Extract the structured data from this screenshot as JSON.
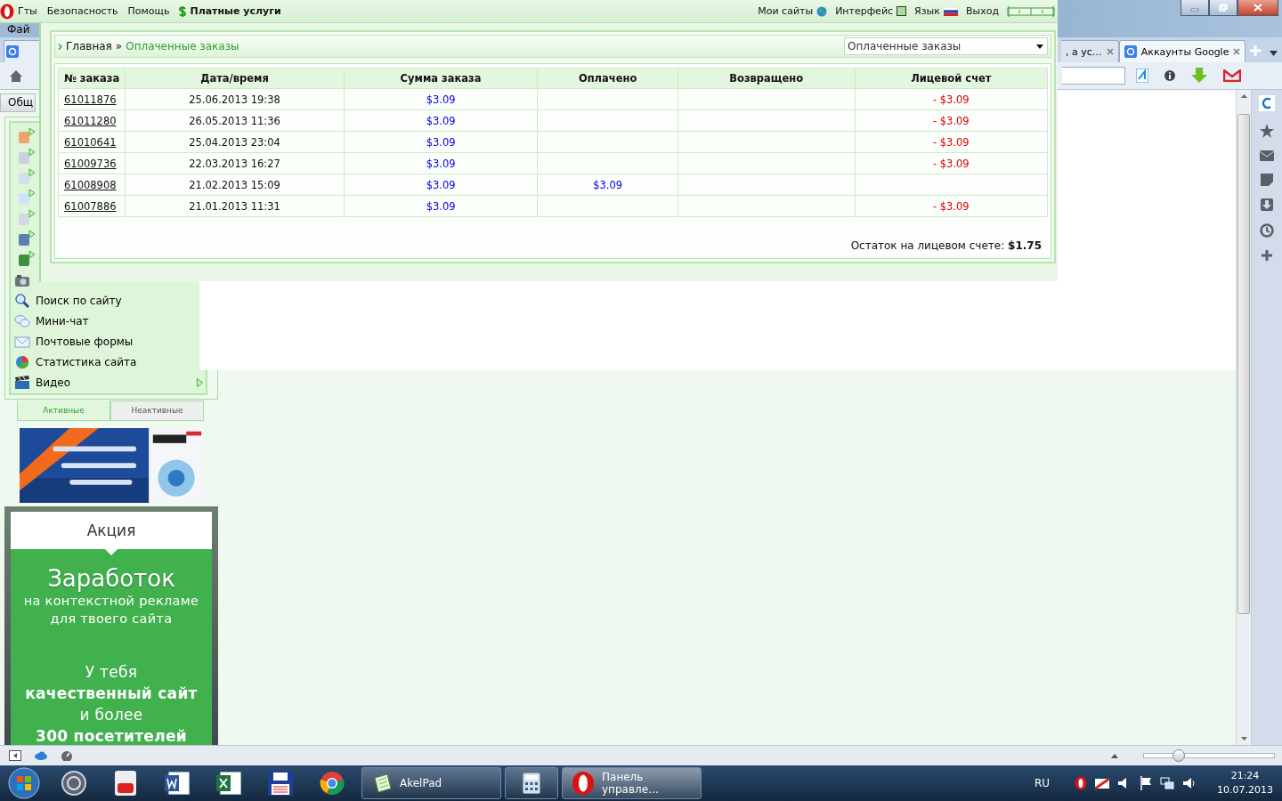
{
  "browser": {
    "menu_fragment": "Фай",
    "tabs": [
      {
        "label": ", а ус…",
        "selected": false
      },
      {
        "label": "Аккаунты Google",
        "selected": true
      }
    ],
    "sidebar_tab": "Общ"
  },
  "panel": {
    "brand_fragment": "Гты",
    "menu": [
      "Безопасность",
      "Помощь"
    ],
    "paid_services": "Платные услуги",
    "right_menu": [
      {
        "kind": "globe",
        "label": "Мои сайты"
      },
      {
        "kind": "square",
        "label": "Интерфейс"
      },
      {
        "kind": "flag",
        "label": "Язык"
      },
      {
        "kind": "plain",
        "label": "Выход"
      }
    ],
    "breadcrumb": {
      "home": "Главная",
      "separator": "»",
      "current": "Оплаченные заказы"
    },
    "section_select": {
      "value": "Оплаченные заказы"
    },
    "table": {
      "columns": [
        "№ заказа",
        "Дата/время",
        "Сумма заказа",
        "Оплачено",
        "Возвращено",
        "Лицевой счет"
      ],
      "rows": [
        {
          "order": "61011876",
          "datetime": "25.06.2013 19:38",
          "amount": "$3.09",
          "account": "- $3.09"
        },
        {
          "order": "61011280",
          "datetime": "26.05.2013 11:36",
          "amount": "$3.09",
          "account": "- $3.09"
        },
        {
          "order": "61010641",
          "datetime": "25.04.2013 23:04",
          "amount": "$3.09",
          "account": "- $3.09"
        },
        {
          "order": "61009736",
          "datetime": "22.03.2013 16:27",
          "amount": "$3.09",
          "account": "- $3.09"
        },
        {
          "order": "61008908",
          "datetime": "21.02.2013 15:09",
          "amount": "$3.09",
          "paid": "$3.09"
        },
        {
          "order": "61007886",
          "datetime": "21.01.2013 11:31",
          "amount": "$3.09",
          "account": "- $3.09"
        }
      ]
    },
    "balance": {
      "label": "Остаток на лицевом счете:",
      "value": "$1.75"
    }
  },
  "sidebar": {
    "items": [
      {
        "kind": "camera",
        "has_submenu": false
      },
      {
        "kind": "search",
        "label": "Поиск по сайту",
        "has_submenu": false
      },
      {
        "kind": "chat",
        "label": "Мини-чат",
        "has_submenu": false
      },
      {
        "kind": "mail",
        "label": "Почтовые формы",
        "has_submenu": false
      },
      {
        "kind": "pie",
        "label": "Статистика сайта",
        "has_submenu": false
      },
      {
        "kind": "video",
        "label": "Видео",
        "has_submenu": true
      }
    ],
    "tabs": [
      {
        "label": "Активные",
        "selected": true
      },
      {
        "label": "Неактивные",
        "selected": false
      }
    ]
  },
  "promo": {
    "title": "Акция",
    "headline": "Заработок",
    "subtitle": "на контекстной рекламе для твоего сайта",
    "lines": [
      {
        "text": "У тебя",
        "bold": false
      },
      {
        "text": "качественный сайт",
        "bold": true
      },
      {
        "text": "и более",
        "bold": false
      },
      {
        "text": "300 посетителей",
        "bold": true
      }
    ]
  },
  "status_bar": {
    "zoom": {
      "level": 0.27
    }
  },
  "taskbar": {
    "windows": [
      {
        "kind": "akelpad",
        "label": "AkelPad",
        "selected": false
      },
      {
        "kind": "calculator",
        "selected": false
      },
      {
        "kind": "opera",
        "label": "Панель управле…",
        "selected": true
      }
    ],
    "language": "RU",
    "time": "21:24",
    "date": "10.07.2013"
  }
}
